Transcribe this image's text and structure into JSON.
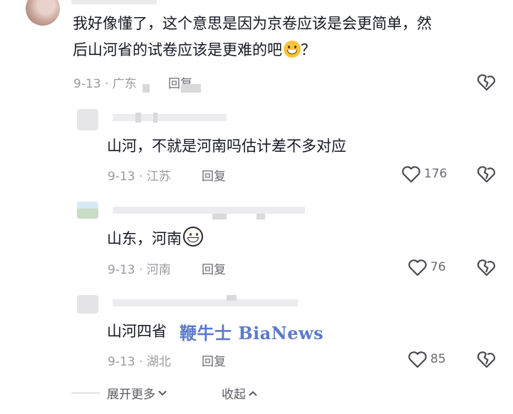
{
  "thread": {
    "expand_label": "展开更多",
    "collapse_label": "收起"
  },
  "main_comment": {
    "text_line1": "我好像懂了，这个意思是因为京卷应该是会更简单，然",
    "text_line2": "后山河省的试卷应该是更难的吧",
    "text_end": "？",
    "date_location": "9-13 · 广东",
    "reply_label": "回复"
  },
  "replies": [
    {
      "text": "山河，不就是河南吗估计差不多对应",
      "date_location": "9-13 · 江苏",
      "reply_label": "回复",
      "likes": "176"
    },
    {
      "text": "山东，河南",
      "date_location": "9-13 · 河南",
      "reply_label": "回复",
      "likes": "76"
    },
    {
      "text": "山河四省",
      "date_location": "9-13 · 湖北",
      "reply_label": "回复",
      "likes": "85"
    }
  ],
  "watermark": "鞭牛士 BiaNews",
  "colors": {
    "text": "#161823",
    "meta": "#9a9aa0",
    "watermark": "#5b7ac8"
  }
}
